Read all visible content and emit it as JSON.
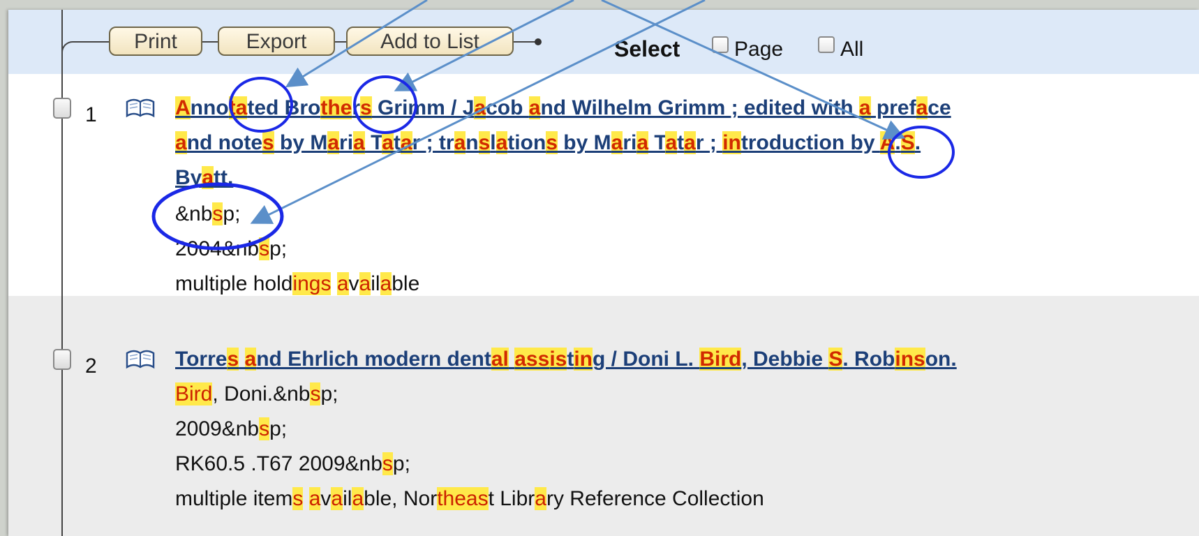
{
  "toolbar": {
    "print_label": "Print",
    "export_label": "Export",
    "add_to_list_label": "Add to List",
    "select_label": "Select",
    "page_label": "Page",
    "all_label": "All"
  },
  "results": [
    {
      "number": "1",
      "title_lines": [
        [
          [
            "A",
            1
          ],
          [
            "nno",
            0
          ],
          [
            "t",
            1
          ],
          [
            "a",
            1
          ],
          [
            "ted Bro",
            0
          ],
          [
            "the",
            1
          ],
          [
            "r",
            0
          ],
          [
            "s",
            1
          ],
          [
            " Grimm / J",
            0
          ],
          [
            "a",
            1
          ],
          [
            "cob ",
            0
          ],
          [
            "a",
            1
          ],
          [
            "nd Wilhelm Grimm ; edited with ",
            0
          ],
          [
            "a",
            1
          ],
          [
            " pref",
            0
          ],
          [
            "a",
            1
          ],
          [
            "ce",
            0
          ]
        ],
        [
          [
            "a",
            1
          ],
          [
            "nd note",
            0
          ],
          [
            "s",
            1
          ],
          [
            " by M",
            0
          ],
          [
            "a",
            1
          ],
          [
            "ri",
            0
          ],
          [
            "a",
            1
          ],
          [
            " T",
            0
          ],
          [
            "a",
            1
          ],
          [
            "t",
            0
          ],
          [
            "a",
            1
          ],
          [
            "r ; tr",
            0
          ],
          [
            "a",
            1
          ],
          [
            "n",
            0
          ],
          [
            "s",
            1
          ],
          [
            "l",
            0
          ],
          [
            "a",
            1
          ],
          [
            "tion",
            0
          ],
          [
            "s",
            1
          ],
          [
            " by M",
            0
          ],
          [
            "a",
            1
          ],
          [
            "ri",
            0
          ],
          [
            "a",
            1
          ],
          [
            " T",
            0
          ],
          [
            "a",
            1
          ],
          [
            "t",
            0
          ],
          [
            "a",
            1
          ],
          [
            "r ; ",
            0
          ],
          [
            "in",
            1
          ],
          [
            "troduction by ",
            0
          ],
          [
            "A",
            1
          ],
          [
            ".",
            0
          ],
          [
            "S",
            1
          ],
          [
            ".",
            0
          ]
        ],
        [
          [
            "By",
            0
          ],
          [
            "a",
            1
          ],
          [
            "tt.",
            0
          ]
        ]
      ],
      "detail_lines": [
        [
          [
            "&nb",
            0
          ],
          [
            "s",
            1
          ],
          [
            "p;",
            0
          ]
        ],
        [
          [
            "2004&nb",
            0
          ],
          [
            "s",
            1
          ],
          [
            "p;",
            0
          ]
        ],
        [
          [
            "multiple hold",
            0
          ],
          [
            "ing",
            1
          ],
          [
            "s",
            1
          ],
          [
            " ",
            0
          ],
          [
            "a",
            1
          ],
          [
            "v",
            0
          ],
          [
            "a",
            1
          ],
          [
            "il",
            0
          ],
          [
            "a",
            1
          ],
          [
            "ble",
            0
          ]
        ]
      ]
    },
    {
      "number": "2",
      "title_lines": [
        [
          [
            "Torre",
            0
          ],
          [
            "s",
            1
          ],
          [
            " ",
            0
          ],
          [
            "a",
            1
          ],
          [
            "nd Ehrlich modern dent",
            0
          ],
          [
            "al",
            1
          ],
          [
            " ",
            0
          ],
          [
            "ass",
            1
          ],
          [
            "is",
            1
          ],
          [
            "t",
            0
          ],
          [
            "in",
            1
          ],
          [
            "g / Doni L. ",
            0
          ],
          [
            "Bird",
            1
          ],
          [
            ", Debbie ",
            0
          ],
          [
            "S",
            1
          ],
          [
            ". Rob",
            0
          ],
          [
            "ins",
            1
          ],
          [
            "on.",
            0
          ]
        ]
      ],
      "detail_lines": [
        [
          [
            "Bird",
            1
          ],
          [
            ", Doni.&nb",
            0
          ],
          [
            "s",
            1
          ],
          [
            "p;",
            0
          ]
        ],
        [
          [
            "2009&nb",
            0
          ],
          [
            "s",
            1
          ],
          [
            "p;",
            0
          ]
        ],
        [
          [
            "RK60.5 .T67 2009&nb",
            0
          ],
          [
            "s",
            1
          ],
          [
            "p;",
            0
          ]
        ],
        [
          [
            "multiple item",
            0
          ],
          [
            "s",
            1
          ],
          [
            " ",
            0
          ],
          [
            "a",
            1
          ],
          [
            "v",
            0
          ],
          [
            "a",
            1
          ],
          [
            "il",
            0
          ],
          [
            "a",
            1
          ],
          [
            "ble, Nor",
            0
          ],
          [
            "theas",
            1
          ],
          [
            "t Libr",
            0
          ],
          [
            "a",
            1
          ],
          [
            "ry Reference Collection",
            0
          ]
        ]
      ]
    }
  ],
  "colors": {
    "highlight_bg": "#ffe94a",
    "highlight_text": "#cc2200",
    "title_link": "#1c3f78",
    "annotation_circle": "#1a28e6",
    "annotation_arrow": "#5b8fc9",
    "toolbar_bg": "#dde9f8",
    "alt_row_bg": "#ececec"
  }
}
